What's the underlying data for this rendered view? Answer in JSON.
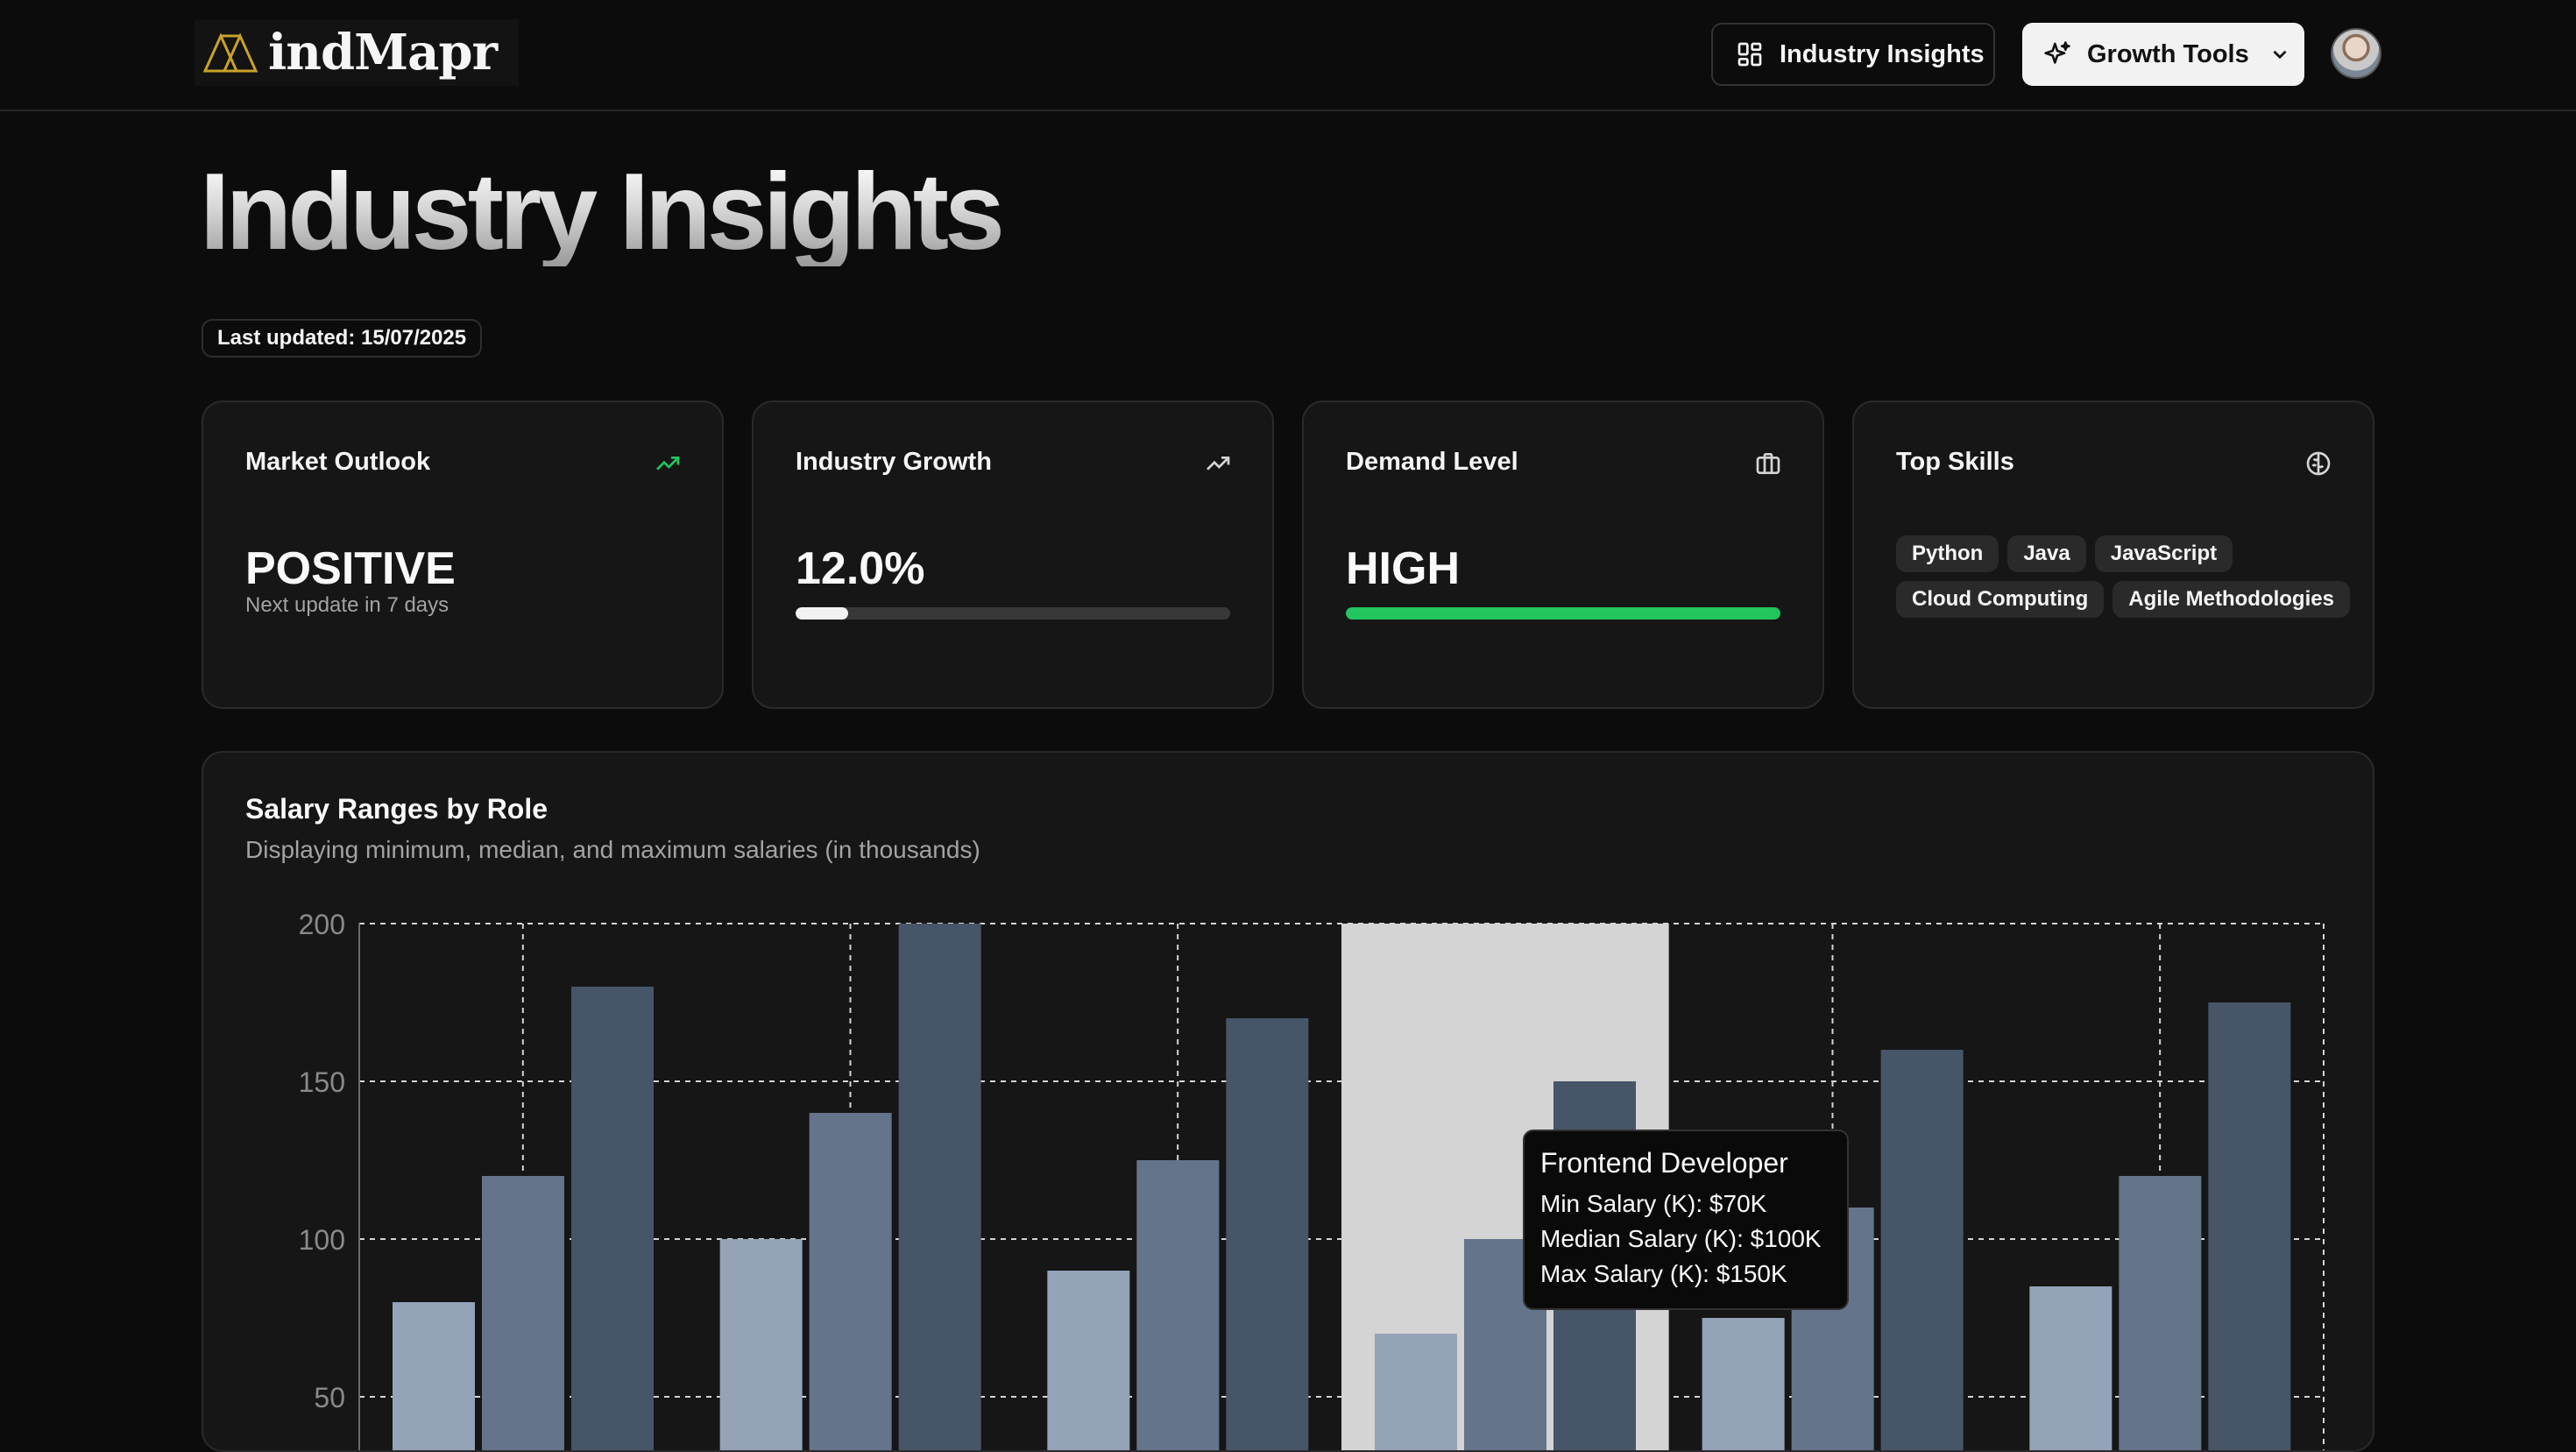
{
  "header": {
    "logo_text": "indMapr",
    "nav_insights_label": "Industry Insights",
    "nav_growth_label": "Growth Tools"
  },
  "page": {
    "title": "Industry Insights",
    "last_updated": "Last updated: 15/07/2025"
  },
  "cards": {
    "market_outlook": {
      "title": "Market Outlook",
      "value": "POSITIVE",
      "sub": "Next update in 7 days",
      "icon": "trending-up-icon",
      "icon_color": "#22c55e"
    },
    "industry_growth": {
      "title": "Industry Growth",
      "value": "12.0%",
      "progress": 0.12,
      "icon": "trending-up-icon"
    },
    "demand_level": {
      "title": "Demand Level",
      "value": "HIGH",
      "progress": 1.0,
      "bar_color": "#22c55e",
      "icon": "briefcase-icon"
    },
    "top_skills": {
      "title": "Top Skills",
      "icon": "brain-icon",
      "skills": [
        "Python",
        "Java",
        "JavaScript",
        "Cloud Computing",
        "Agile Methodologies"
      ]
    }
  },
  "chart": {
    "title": "Salary Ranges by Role",
    "subtitle": "Displaying minimum, median, and maximum salaries (in thousands)",
    "tooltip": {
      "title": "Frontend Developer",
      "min_line": "Min Salary (K): $70K",
      "median_line": "Median Salary (K): $100K",
      "max_line": "Max Salary (K): $150K"
    }
  },
  "chart_data": {
    "type": "bar",
    "title": "Salary Ranges by Role",
    "ylim": [
      50,
      200
    ],
    "y_ticks": [
      200,
      150,
      100,
      50
    ],
    "grid": true,
    "highlighted_index": 3,
    "series": [
      {
        "name": "Min Salary (K)",
        "color": "#94a3b8",
        "values": [
          80,
          100,
          90,
          70,
          75,
          85
        ]
      },
      {
        "name": "Median Salary (K)",
        "color": "#64748b",
        "values": [
          120,
          140,
          125,
          100,
          110,
          120
        ]
      },
      {
        "name": "Max Salary (K)",
        "color": "#475569",
        "values": [
          180,
          200,
          170,
          150,
          160,
          175
        ]
      }
    ]
  }
}
